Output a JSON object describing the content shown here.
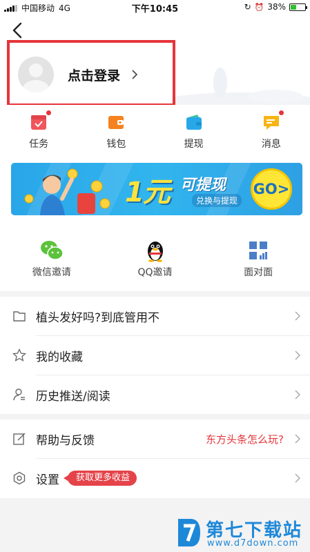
{
  "status_bar": {
    "carrier": "中国移动",
    "network": "4G",
    "time": "下午10:45",
    "battery": "38%",
    "battery_level": 0.38
  },
  "login": {
    "text": "点击登录"
  },
  "quick_items": [
    {
      "label": "任务",
      "icon": "task-calendar-icon",
      "color": "#f0565b",
      "dot": true
    },
    {
      "label": "钱包",
      "icon": "wallet-icon",
      "color": "#f5821f",
      "dot": false
    },
    {
      "label": "提现",
      "icon": "withdraw-wallet-icon",
      "color": "#27a8e8",
      "dot": false
    },
    {
      "label": "消息",
      "icon": "message-bubble-icon",
      "color": "#f7b515",
      "dot": true
    }
  ],
  "banner": {
    "big": "1元",
    "title": "可提现",
    "sub": "兑换与提现",
    "go": "GO>"
  },
  "invite_items": [
    {
      "label": "微信邀请",
      "icon": "wechat-icon"
    },
    {
      "label": "QQ邀请",
      "icon": "qq-penguin-icon"
    },
    {
      "label": "面对面",
      "icon": "qr-code-icon"
    }
  ],
  "list1": [
    {
      "label": "植头发好吗?到底管用不",
      "icon": "folder-icon"
    },
    {
      "label": "我的收藏",
      "icon": "star-icon"
    },
    {
      "label": "历史推送/阅读",
      "icon": "person-history-icon"
    }
  ],
  "list2": [
    {
      "label": "帮助与反馈",
      "icon": "edit-note-icon",
      "hint": "东方头条怎么玩?"
    },
    {
      "label": "设置",
      "icon": "settings-hex-icon",
      "tag": "获取更多收益"
    }
  ],
  "watermark": {
    "title": "第七下载站",
    "url": "www.d7down.com"
  },
  "colors": {
    "accent_red": "#e5353a",
    "banner_blue": "#2aa6e8",
    "watermark_blue": "#1e88d8"
  }
}
